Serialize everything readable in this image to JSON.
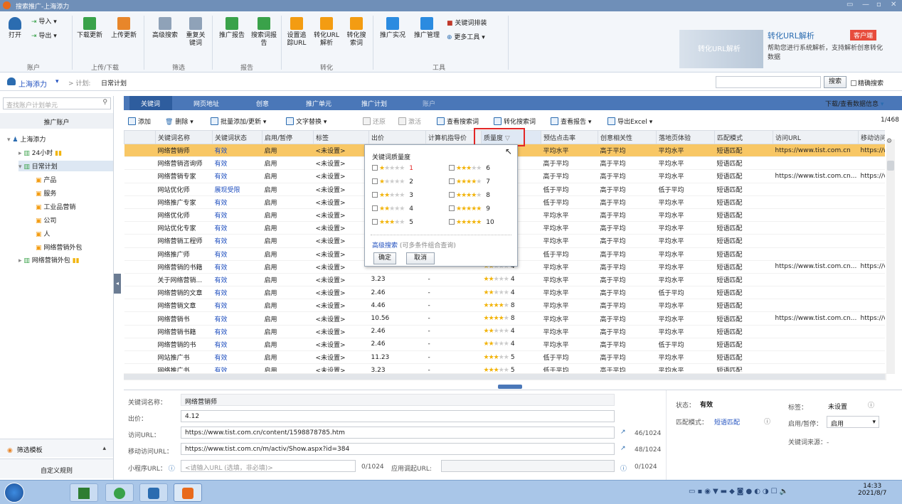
{
  "window": {
    "title": "搜索推广-上海添力"
  },
  "ribbon": {
    "buttons": [
      {
        "label": "打开",
        "color": "#2b6cb0"
      },
      {
        "label": "导入 ▾"
      },
      {
        "label": "导出 ▾"
      },
      {
        "label": "下载更新",
        "color": "#3aa24a"
      },
      {
        "label": "上传更新",
        "color": "#e8862a"
      },
      {
        "label": "高级搜索",
        "color": "#6b7c93"
      },
      {
        "label": "重复关键词",
        "color": "#6b7c93"
      },
      {
        "label": "推广报告",
        "color": "#3aa24a"
      },
      {
        "label": "搜索词报告",
        "color": "#3aa24a"
      },
      {
        "label": "设置追踪URL",
        "color": "#f39c12"
      },
      {
        "label": "转化URL解析",
        "color": "#f39c12"
      },
      {
        "label": "转化搜索词",
        "color": "#f39c12"
      },
      {
        "label": "推广实况",
        "color": "#2b8be0"
      },
      {
        "label": "推广管理",
        "color": "#2b8be0"
      },
      {
        "label": "关键词排装"
      },
      {
        "label": "更多工具 ▾"
      }
    ],
    "groups": [
      "账户",
      "上传/下载",
      "筛选",
      "报告",
      "转化",
      "工具"
    ],
    "promo": {
      "title": "转化URL解析",
      "badge": "客户端",
      "desc": "帮助您进行系统解析，支持解析创意转化数据",
      "img_text": "转化URL解析"
    }
  },
  "nav": {
    "account": "上海添力",
    "plan_prefix": "> 计划:",
    "plan": "日常计划",
    "search_btn": "搜索",
    "exact": "精确搜索"
  },
  "left": {
    "search_placeholder": "查找账户计划单元",
    "header": "推广账户",
    "tree": [
      "上海添力",
      "24小时",
      "日常计划",
      "产品",
      "服务",
      "工业品营销",
      "公司",
      "人",
      "网络营销外包",
      "网络营销外包"
    ],
    "bottom": [
      "筛选模板",
      "自定义规则"
    ]
  },
  "tabs": [
    "关键词",
    "网页地址",
    "创意",
    "推广单元",
    "推广计划",
    "账户"
  ],
  "tabs_right": "下载/查看数据信息",
  "toolbar": {
    "items": [
      "添加",
      "删除",
      "批量添加/更新",
      "文字替换",
      "还原",
      "激活",
      "查看搜索词",
      "转化搜索词",
      "查看报告",
      "导出Excel"
    ],
    "pager": "1/468"
  },
  "grid": {
    "columns": [
      "关键词名称",
      "关键词状态",
      "启用/暂停",
      "标签",
      "出价",
      "计算机指导价",
      "质量度",
      "预估点击率",
      "创意相关性",
      "落地页体验",
      "匹配模式",
      "访问URL",
      "移动访问"
    ],
    "rows": [
      [
        "网络营销师",
        "有效",
        "启用",
        "<未设置>",
        "4.12",
        "-",
        "8",
        "平均水平",
        "高于平均",
        "平均水平",
        "短语匹配",
        "https://www.tist.com.cn",
        "https://w"
      ],
      [
        "网络营销咨询师",
        "有效",
        "启用",
        "<未设置>",
        "",
        "",
        "9",
        "高于平均",
        "高于平均",
        "平均水平",
        "短语匹配",
        "",
        ""
      ],
      [
        "网络营销专家",
        "有效",
        "启用",
        "<未设置>",
        "",
        "",
        "9",
        "高于平均",
        "高于平均",
        "平均水平",
        "短语匹配",
        "https://www.tist.com.cn...",
        "https://v"
      ],
      [
        "网站优化师",
        "展现受限",
        "启用",
        "<未设置>",
        "",
        "",
        "2",
        "低于平均",
        "高于平均",
        "低于平均",
        "短语匹配",
        "",
        ""
      ],
      [
        "网络推广专家",
        "有效",
        "启用",
        "<未设置>",
        "",
        "",
        "5",
        "低于平均",
        "高于平均",
        "平均水平",
        "短语匹配",
        "",
        ""
      ],
      [
        "网络优化师",
        "有效",
        "启用",
        "<未设置>",
        "",
        "",
        "8",
        "平均水平",
        "高于平均",
        "平均水平",
        "短语匹配",
        "",
        ""
      ],
      [
        "网站优化专家",
        "有效",
        "启用",
        "<未设置>",
        "",
        "",
        "4",
        "平均水平",
        "高于平均",
        "平均水平",
        "短语匹配",
        "",
        ""
      ],
      [
        "网络营销工程师",
        "有效",
        "启用",
        "<未设置>",
        "",
        "",
        "8",
        "平均水平",
        "高于平均",
        "平均水平",
        "短语匹配",
        "",
        ""
      ],
      [
        "网络推广师",
        "有效",
        "启用",
        "<未设置>",
        "",
        "",
        "4",
        "低于平均",
        "高于平均",
        "平均水平",
        "短语匹配",
        "",
        ""
      ],
      [
        "网络营销的书籍",
        "有效",
        "启用",
        "<未设置>",
        "",
        "",
        "4",
        "平均水平",
        "高于平均",
        "平均水平",
        "短语匹配",
        "https://www.tist.com.cn...",
        "https://v"
      ],
      [
        "关于网络营销...",
        "有效",
        "启用",
        "<未设置>",
        "3.23",
        "-",
        "4",
        "平均水平",
        "高于平均",
        "平均水平",
        "短语匹配",
        "",
        ""
      ],
      [
        "网络营销的文章",
        "有效",
        "启用",
        "<未设置>",
        "2.46",
        "-",
        "4",
        "平均水平",
        "高于平均",
        "低于平均",
        "短语匹配",
        "",
        ""
      ],
      [
        "网络营销文章",
        "有效",
        "启用",
        "<未设置>",
        "4.46",
        "-",
        "8",
        "平均水平",
        "高于平均",
        "平均水平",
        "短语匹配",
        "",
        ""
      ],
      [
        "网络营销书",
        "有效",
        "启用",
        "<未设置>",
        "10.56",
        "-",
        "8",
        "平均水平",
        "高于平均",
        "平均水平",
        "短语匹配",
        "https://www.tist.com.cn...",
        "https://v"
      ],
      [
        "网络营销书籍",
        "有效",
        "启用",
        "<未设置>",
        "2.46",
        "-",
        "4",
        "平均水平",
        "高于平均",
        "平均水平",
        "短语匹配",
        "",
        ""
      ],
      [
        "网络营销的书",
        "有效",
        "启用",
        "<未设置>",
        "2.46",
        "-",
        "4",
        "平均水平",
        "高于平均",
        "低于平均",
        "短语匹配",
        "",
        ""
      ],
      [
        "网站推广书",
        "有效",
        "启用",
        "<未设置>",
        "11.23",
        "-",
        "5",
        "低于平均",
        "高于平均",
        "平均水平",
        "短语匹配",
        "",
        ""
      ],
      [
        "网络推广书",
        "有效",
        "启用",
        "<未设置>",
        "3.23",
        "-",
        "5",
        "低于平均",
        "高于平均",
        "平均水平",
        "短语匹配",
        "",
        ""
      ]
    ]
  },
  "popup": {
    "title": "关键词质量度",
    "levels": [
      "1",
      "2",
      "3",
      "4",
      "5",
      "6",
      "7",
      "8",
      "9",
      "10"
    ],
    "adv": "高级搜索",
    "adv_hint": "(可多条件组合查询)",
    "ok": "确定",
    "cancel": "取消"
  },
  "detail": {
    "name_label": "关键词名称：",
    "name": "网络营销师",
    "bid_label": "出价：",
    "bid": "4.12",
    "url_label": "访问URL：",
    "url": "https://www.tist.com.cn/content/1598878785.htm",
    "url_count": "46/1024",
    "murl_label": "移动访问URL：",
    "murl": "https://www.tist.com.cn/m/activ/Show.aspx?id=384",
    "murl_count": "48/1024",
    "mini_label": "小程序URL：",
    "mini_placeholder": "<请输入URL (选填，非必填)>",
    "mini_count": "0/1024",
    "app_label": "应用调起URL:",
    "app_count": "0/1024",
    "status_label": "状态：",
    "status": "有效",
    "tag_label": "标签：",
    "tag": "未设置",
    "match_label": "匹配模式：",
    "match": "短语匹配",
    "enable_label": "启用/暂停：",
    "enable": "启用",
    "source_label": "关键词来源：-"
  },
  "taskbar": {
    "time": "14:33",
    "date": "2021/8/7"
  }
}
